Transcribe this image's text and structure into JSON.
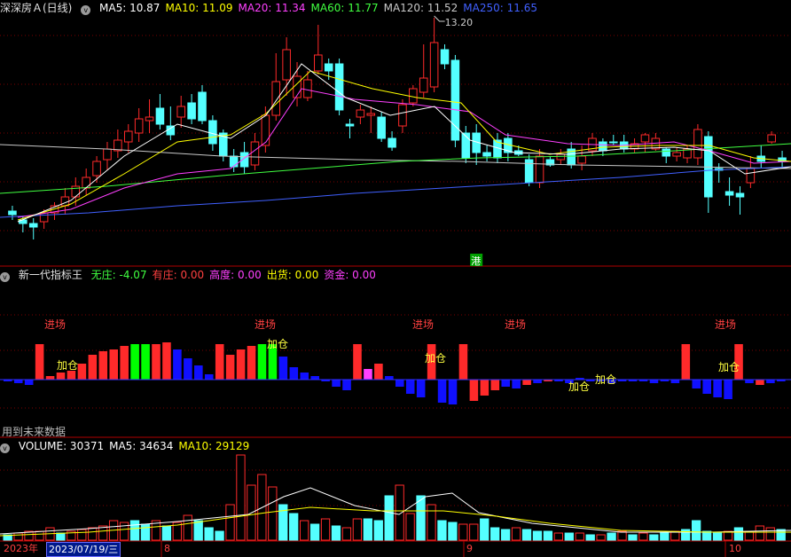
{
  "main": {
    "title": "深深房Ａ(日线)",
    "ma": [
      {
        "label": "MA5: 10.87",
        "color": "#ffffff"
      },
      {
        "label": "MA10: 11.09",
        "color": "#ffff00"
      },
      {
        "label": "MA20: 11.34",
        "color": "#ff40ff"
      },
      {
        "label": "MA60: 11.77",
        "color": "#40ff40"
      },
      {
        "label": "MA120: 11.52",
        "color": "#c8c8c8"
      },
      {
        "label": "MA250: 11.65",
        "color": "#4060ff"
      }
    ],
    "high_label": "13.20",
    "badge": "港"
  },
  "indicator": {
    "title": "新一代指标王",
    "values": [
      {
        "label": "无庄: -4.07",
        "color": "#40ff40"
      },
      {
        "label": "有庄: 0.00",
        "color": "#ff4040"
      },
      {
        "label": "高度: 0.00",
        "color": "#ff40ff"
      },
      {
        "label": "出货: 0.00",
        "color": "#ffff00"
      },
      {
        "label": "资金: 0.00",
        "color": "#ff40ff"
      }
    ],
    "enter_label": "进场",
    "add_label": "加仓",
    "future_note": "用到未来数据"
  },
  "volume": {
    "values": [
      {
        "label": "VOLUME: 30371",
        "color": "#ffffff"
      },
      {
        "label": "MA5: 34634",
        "color": "#ffffff"
      },
      {
        "label": "MA10: 29129",
        "color": "#ffff00"
      }
    ]
  },
  "axis": {
    "year": "2023年",
    "selected_date": "2023/07/19/三",
    "month_ticks": [
      "8",
      "9",
      "10"
    ]
  },
  "colors": {
    "up": "#ff2a2a",
    "down": "#54ffff",
    "grid": "#7a0000",
    "ind_green": "#00ff00",
    "ind_blue": "#1010ff"
  }
}
